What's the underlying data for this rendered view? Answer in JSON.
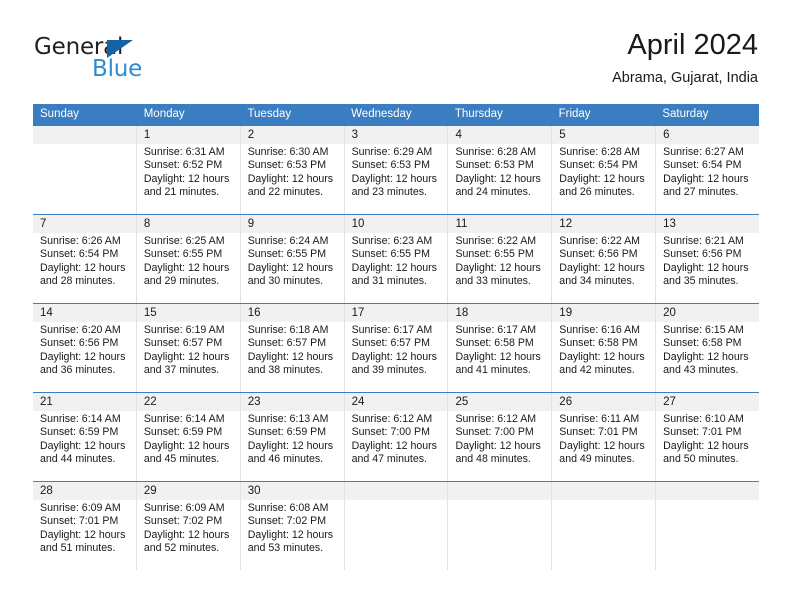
{
  "brand": {
    "name_part1": "General",
    "name_part2": "Blue",
    "triangle_color": "#1464a5",
    "blue_color": "#2e8bd0"
  },
  "header": {
    "title": "April 2024",
    "location": "Abrama, Gujarat, India"
  },
  "theme": {
    "header_bar_color": "#3a7dc0",
    "daynum_bg": "#f1f1f1",
    "row_divider_color": "#3a7dc0",
    "column_divider_color": "#e2e2e2"
  },
  "weekday_headers": [
    "Sunday",
    "Monday",
    "Tuesday",
    "Wednesday",
    "Thursday",
    "Friday",
    "Saturday"
  ],
  "weeks": [
    [
      {
        "day": "",
        "sunrise": "",
        "sunset": "",
        "daylight_line1": "",
        "daylight_line2": ""
      },
      {
        "day": "1",
        "sunrise": "Sunrise: 6:31 AM",
        "sunset": "Sunset: 6:52 PM",
        "daylight_line1": "Daylight: 12 hours",
        "daylight_line2": "and 21 minutes."
      },
      {
        "day": "2",
        "sunrise": "Sunrise: 6:30 AM",
        "sunset": "Sunset: 6:53 PM",
        "daylight_line1": "Daylight: 12 hours",
        "daylight_line2": "and 22 minutes."
      },
      {
        "day": "3",
        "sunrise": "Sunrise: 6:29 AM",
        "sunset": "Sunset: 6:53 PM",
        "daylight_line1": "Daylight: 12 hours",
        "daylight_line2": "and 23 minutes."
      },
      {
        "day": "4",
        "sunrise": "Sunrise: 6:28 AM",
        "sunset": "Sunset: 6:53 PM",
        "daylight_line1": "Daylight: 12 hours",
        "daylight_line2": "and 24 minutes."
      },
      {
        "day": "5",
        "sunrise": "Sunrise: 6:28 AM",
        "sunset": "Sunset: 6:54 PM",
        "daylight_line1": "Daylight: 12 hours",
        "daylight_line2": "and 26 minutes."
      },
      {
        "day": "6",
        "sunrise": "Sunrise: 6:27 AM",
        "sunset": "Sunset: 6:54 PM",
        "daylight_line1": "Daylight: 12 hours",
        "daylight_line2": "and 27 minutes."
      }
    ],
    [
      {
        "day": "7",
        "sunrise": "Sunrise: 6:26 AM",
        "sunset": "Sunset: 6:54 PM",
        "daylight_line1": "Daylight: 12 hours",
        "daylight_line2": "and 28 minutes."
      },
      {
        "day": "8",
        "sunrise": "Sunrise: 6:25 AM",
        "sunset": "Sunset: 6:55 PM",
        "daylight_line1": "Daylight: 12 hours",
        "daylight_line2": "and 29 minutes."
      },
      {
        "day": "9",
        "sunrise": "Sunrise: 6:24 AM",
        "sunset": "Sunset: 6:55 PM",
        "daylight_line1": "Daylight: 12 hours",
        "daylight_line2": "and 30 minutes."
      },
      {
        "day": "10",
        "sunrise": "Sunrise: 6:23 AM",
        "sunset": "Sunset: 6:55 PM",
        "daylight_line1": "Daylight: 12 hours",
        "daylight_line2": "and 31 minutes."
      },
      {
        "day": "11",
        "sunrise": "Sunrise: 6:22 AM",
        "sunset": "Sunset: 6:55 PM",
        "daylight_line1": "Daylight: 12 hours",
        "daylight_line2": "and 33 minutes."
      },
      {
        "day": "12",
        "sunrise": "Sunrise: 6:22 AM",
        "sunset": "Sunset: 6:56 PM",
        "daylight_line1": "Daylight: 12 hours",
        "daylight_line2": "and 34 minutes."
      },
      {
        "day": "13",
        "sunrise": "Sunrise: 6:21 AM",
        "sunset": "Sunset: 6:56 PM",
        "daylight_line1": "Daylight: 12 hours",
        "daylight_line2": "and 35 minutes."
      }
    ],
    [
      {
        "day": "14",
        "sunrise": "Sunrise: 6:20 AM",
        "sunset": "Sunset: 6:56 PM",
        "daylight_line1": "Daylight: 12 hours",
        "daylight_line2": "and 36 minutes."
      },
      {
        "day": "15",
        "sunrise": "Sunrise: 6:19 AM",
        "sunset": "Sunset: 6:57 PM",
        "daylight_line1": "Daylight: 12 hours",
        "daylight_line2": "and 37 minutes."
      },
      {
        "day": "16",
        "sunrise": "Sunrise: 6:18 AM",
        "sunset": "Sunset: 6:57 PM",
        "daylight_line1": "Daylight: 12 hours",
        "daylight_line2": "and 38 minutes."
      },
      {
        "day": "17",
        "sunrise": "Sunrise: 6:17 AM",
        "sunset": "Sunset: 6:57 PM",
        "daylight_line1": "Daylight: 12 hours",
        "daylight_line2": "and 39 minutes."
      },
      {
        "day": "18",
        "sunrise": "Sunrise: 6:17 AM",
        "sunset": "Sunset: 6:58 PM",
        "daylight_line1": "Daylight: 12 hours",
        "daylight_line2": "and 41 minutes."
      },
      {
        "day": "19",
        "sunrise": "Sunrise: 6:16 AM",
        "sunset": "Sunset: 6:58 PM",
        "daylight_line1": "Daylight: 12 hours",
        "daylight_line2": "and 42 minutes."
      },
      {
        "day": "20",
        "sunrise": "Sunrise: 6:15 AM",
        "sunset": "Sunset: 6:58 PM",
        "daylight_line1": "Daylight: 12 hours",
        "daylight_line2": "and 43 minutes."
      }
    ],
    [
      {
        "day": "21",
        "sunrise": "Sunrise: 6:14 AM",
        "sunset": "Sunset: 6:59 PM",
        "daylight_line1": "Daylight: 12 hours",
        "daylight_line2": "and 44 minutes."
      },
      {
        "day": "22",
        "sunrise": "Sunrise: 6:14 AM",
        "sunset": "Sunset: 6:59 PM",
        "daylight_line1": "Daylight: 12 hours",
        "daylight_line2": "and 45 minutes."
      },
      {
        "day": "23",
        "sunrise": "Sunrise: 6:13 AM",
        "sunset": "Sunset: 6:59 PM",
        "daylight_line1": "Daylight: 12 hours",
        "daylight_line2": "and 46 minutes."
      },
      {
        "day": "24",
        "sunrise": "Sunrise: 6:12 AM",
        "sunset": "Sunset: 7:00 PM",
        "daylight_line1": "Daylight: 12 hours",
        "daylight_line2": "and 47 minutes."
      },
      {
        "day": "25",
        "sunrise": "Sunrise: 6:12 AM",
        "sunset": "Sunset: 7:00 PM",
        "daylight_line1": "Daylight: 12 hours",
        "daylight_line2": "and 48 minutes."
      },
      {
        "day": "26",
        "sunrise": "Sunrise: 6:11 AM",
        "sunset": "Sunset: 7:01 PM",
        "daylight_line1": "Daylight: 12 hours",
        "daylight_line2": "and 49 minutes."
      },
      {
        "day": "27",
        "sunrise": "Sunrise: 6:10 AM",
        "sunset": "Sunset: 7:01 PM",
        "daylight_line1": "Daylight: 12 hours",
        "daylight_line2": "and 50 minutes."
      }
    ],
    [
      {
        "day": "28",
        "sunrise": "Sunrise: 6:09 AM",
        "sunset": "Sunset: 7:01 PM",
        "daylight_line1": "Daylight: 12 hours",
        "daylight_line2": "and 51 minutes."
      },
      {
        "day": "29",
        "sunrise": "Sunrise: 6:09 AM",
        "sunset": "Sunset: 7:02 PM",
        "daylight_line1": "Daylight: 12 hours",
        "daylight_line2": "and 52 minutes."
      },
      {
        "day": "30",
        "sunrise": "Sunrise: 6:08 AM",
        "sunset": "Sunset: 7:02 PM",
        "daylight_line1": "Daylight: 12 hours",
        "daylight_line2": "and 53 minutes."
      },
      {
        "day": "",
        "sunrise": "",
        "sunset": "",
        "daylight_line1": "",
        "daylight_line2": ""
      },
      {
        "day": "",
        "sunrise": "",
        "sunset": "",
        "daylight_line1": "",
        "daylight_line2": ""
      },
      {
        "day": "",
        "sunrise": "",
        "sunset": "",
        "daylight_line1": "",
        "daylight_line2": ""
      },
      {
        "day": "",
        "sunrise": "",
        "sunset": "",
        "daylight_line1": "",
        "daylight_line2": ""
      }
    ]
  ]
}
